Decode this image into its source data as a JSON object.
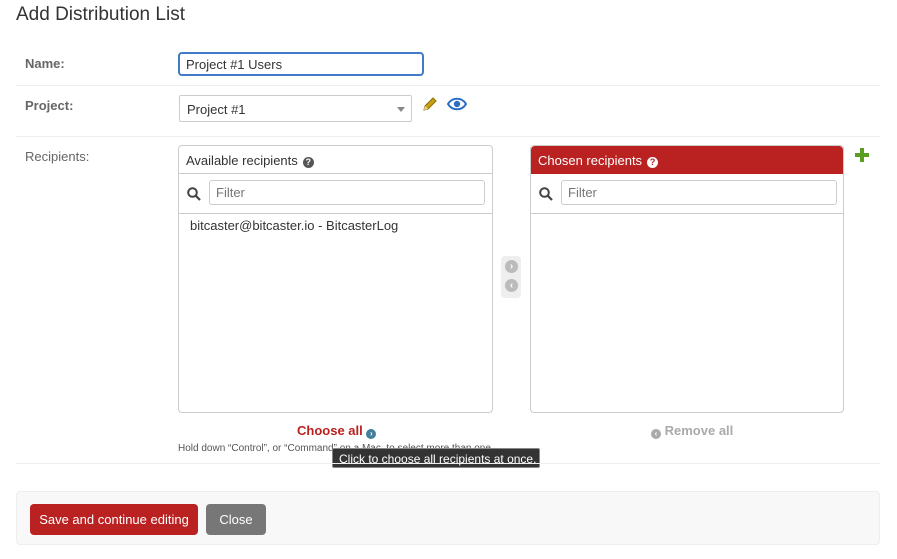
{
  "page": {
    "title": "Add Distribution List"
  },
  "form": {
    "name_label": "Name:",
    "name_value": "Project #1 Users",
    "project_label": "Project:",
    "project_value": "Project #1",
    "recipients_label": "Recipients:"
  },
  "available": {
    "title": "Available recipients",
    "filter_placeholder": "Filter",
    "items": [
      "bitcaster@bitcaster.io - BitcasterLog"
    ],
    "choose_all": "Choose all"
  },
  "chosen": {
    "title": "Chosen recipients",
    "filter_placeholder": "Filter",
    "remove_all": "Remove all"
  },
  "help_text": "Hold down “Control”, or “Command” on a Mac, to select more than one.",
  "tooltip": "Click to choose all recipients at once.",
  "buttons": {
    "save": "Save and continue editing",
    "close": "Close"
  },
  "colors": {
    "accent": "#ba2121",
    "focus": "#417ac9",
    "add": "#5a9e21",
    "edit": "#c7a016",
    "view": "#2a6dc4"
  }
}
